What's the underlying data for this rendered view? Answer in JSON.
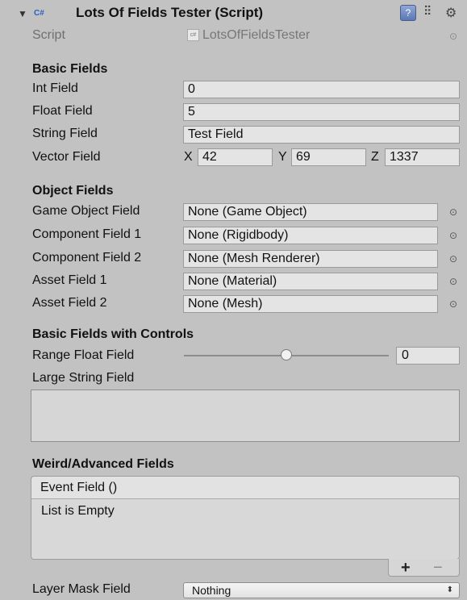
{
  "component": {
    "foldout_icon": "triangle-down-icon",
    "type_badge": "C#",
    "title": "Lots Of Fields Tester (Script)",
    "header_icons": [
      "help-book-icon",
      "preset-sliders-icon",
      "gear-menu-icon"
    ]
  },
  "script": {
    "label": "Script",
    "value": "LotsOfFieldsTester"
  },
  "basic_fields": {
    "heading": "Basic Fields",
    "int": {
      "label": "Int Field",
      "value": "0"
    },
    "float": {
      "label": "Float Field",
      "value": "5"
    },
    "string": {
      "label": "String Field",
      "value": "Test Field"
    },
    "vector": {
      "label": "Vector Field",
      "x_label": "X",
      "x": "42",
      "y_label": "Y",
      "y": "69",
      "z_label": "Z",
      "z": "1337"
    }
  },
  "object_fields": {
    "heading": "Object Fields",
    "items": [
      {
        "label": "Game Object Field",
        "value": "None (Game Object)"
      },
      {
        "label": "Component Field 1",
        "value": "None (Rigidbody)"
      },
      {
        "label": "Component Field 2",
        "value": "None (Mesh Renderer)"
      },
      {
        "label": "Asset Field 1",
        "value": "None (Material)"
      },
      {
        "label": "Asset Field 2",
        "value": "None (Mesh)"
      }
    ]
  },
  "controls": {
    "heading": "Basic Fields with Controls",
    "range": {
      "label": "Range Float Field",
      "value": "0",
      "slider_fraction": 0.5
    },
    "large_string": {
      "label": "Large String Field",
      "value": ""
    }
  },
  "advanced": {
    "heading": "Weird/Advanced Fields",
    "event": {
      "header": "Event Field ()",
      "empty_text": "List is Empty",
      "add": "+",
      "remove": "−"
    },
    "layer_mask": {
      "label": "Layer Mask Field",
      "value": "Nothing",
      "arrow": "⬍"
    }
  }
}
